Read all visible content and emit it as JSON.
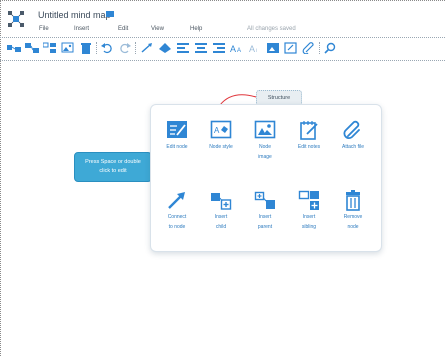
{
  "app": {
    "title": "Untitled mind map",
    "status": "All changes saved"
  },
  "menu": [
    {
      "id": "file",
      "label": "File"
    },
    {
      "id": "insert",
      "label": "Insert"
    },
    {
      "id": "edit",
      "label": "Edit"
    },
    {
      "id": "view",
      "label": "View"
    },
    {
      "id": "help",
      "label": "Help"
    }
  ],
  "toolbar": {
    "icons": [
      "insert-child-icon",
      "insert-parent-icon",
      "insert-sibling-icon",
      "image-icon",
      "trash-icon",
      "undo-icon",
      "redo-icon",
      "connect-icon",
      "color-icon",
      "align-left-icon",
      "align-center-icon",
      "align-right-icon",
      "font-size-icon",
      "font-icon",
      "image-node-icon",
      "note-icon",
      "link-icon",
      "search-icon"
    ]
  },
  "canvas": {
    "root_node": {
      "line1": "Press Space or double",
      "line2": "click to edit"
    },
    "child_node": {
      "label": "Structure"
    }
  },
  "context_menu": {
    "row1": [
      {
        "id": "edit-node",
        "label1": "Edit node",
        "label2": ""
      },
      {
        "id": "node-style",
        "label1": "Node style",
        "label2": ""
      },
      {
        "id": "node-image",
        "label1": "Node",
        "label2": "image"
      },
      {
        "id": "edit-notes",
        "label1": "Edit notes",
        "label2": ""
      },
      {
        "id": "attach-file",
        "label1": "Attach file",
        "label2": ""
      }
    ],
    "row2": [
      {
        "id": "connect-to-node",
        "label1": "Connect",
        "label2": "to node"
      },
      {
        "id": "insert-child",
        "label1": "Insert",
        "label2": "child"
      },
      {
        "id": "insert-parent",
        "label1": "Insert",
        "label2": "parent"
      },
      {
        "id": "insert-sibling",
        "label1": "Insert",
        "label2": "sibling"
      },
      {
        "id": "remove-node",
        "label1": "Remove",
        "label2": "node"
      }
    ]
  },
  "colors": {
    "accent": "#2f86d4",
    "node_fill": "#3ea9d6",
    "connector": "#e0343a",
    "icon": "#2f86d4"
  }
}
